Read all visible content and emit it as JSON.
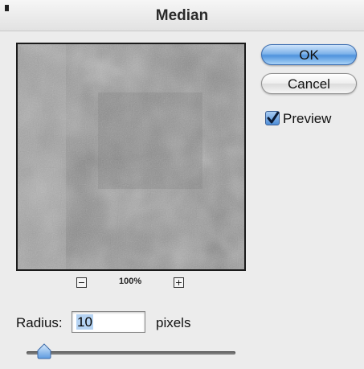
{
  "window": {
    "title": "Median"
  },
  "buttons": {
    "ok_label": "OK",
    "cancel_label": "Cancel"
  },
  "preview": {
    "checkbox_label": "Preview",
    "checked": true
  },
  "zoom": {
    "level_text": "100%",
    "minus_label": "−",
    "plus_label": "+"
  },
  "radius": {
    "label": "Radius:",
    "value": "10",
    "units": "pixels"
  },
  "slider": {
    "value": 10
  },
  "icons": [
    "zoom-out-icon",
    "zoom-in-icon",
    "checkmark-icon"
  ],
  "colors": {
    "ok_accent": "#4f93dd",
    "dialog_bg": "#ececec"
  }
}
